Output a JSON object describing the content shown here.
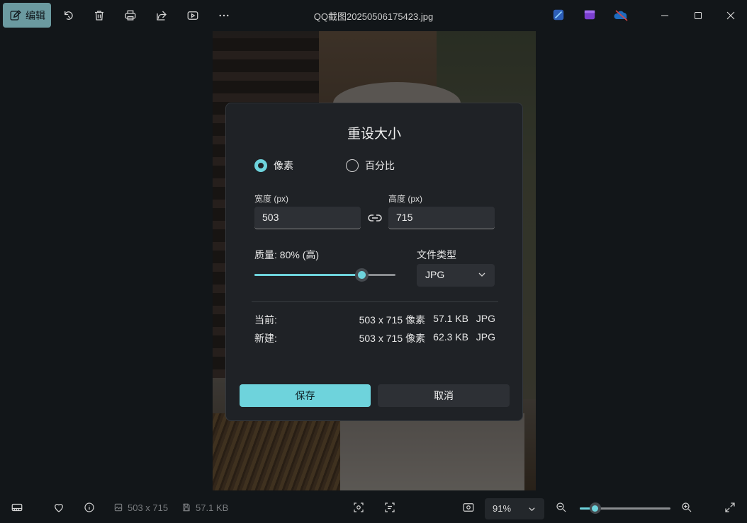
{
  "toolbar": {
    "edit_label": "编辑",
    "icons": [
      "edit-icon",
      "rotate-icon",
      "delete-icon",
      "print-icon",
      "share-icon",
      "slideshow-icon",
      "more-icon"
    ]
  },
  "window": {
    "title": "QQ截图20250506175423.jpg",
    "app_icons": [
      "clipchamp-icon",
      "video-editor-icon",
      "onedrive-icon"
    ]
  },
  "dialog": {
    "title": "重设大小",
    "radio_pixels": "像素",
    "radio_percent": "百分比",
    "selected_unit": "像素",
    "width_label": "宽度 (px)",
    "width_value": "503",
    "height_label": "高度 (px)",
    "height_value": "715",
    "quality_label": "质量: 80% (高)",
    "quality_percent": 80,
    "filetype_label": "文件类型",
    "filetype_value": "JPG",
    "current": {
      "label": "当前:",
      "dims": "503 x 715 像素",
      "size": "57.1 KB",
      "format": "JPG"
    },
    "new": {
      "label": "新建:",
      "dims": "503 x 715 像素",
      "size": "62.3 KB",
      "format": "JPG"
    },
    "save_label": "保存",
    "cancel_label": "取消"
  },
  "statusbar": {
    "dimensions": "503 x 715",
    "filesize": "57.1 KB",
    "zoom": "91%",
    "zoom_percent": 17
  },
  "colors": {
    "accent": "#6ed3dc",
    "background": "#121619",
    "dialog": "#1f2226"
  }
}
